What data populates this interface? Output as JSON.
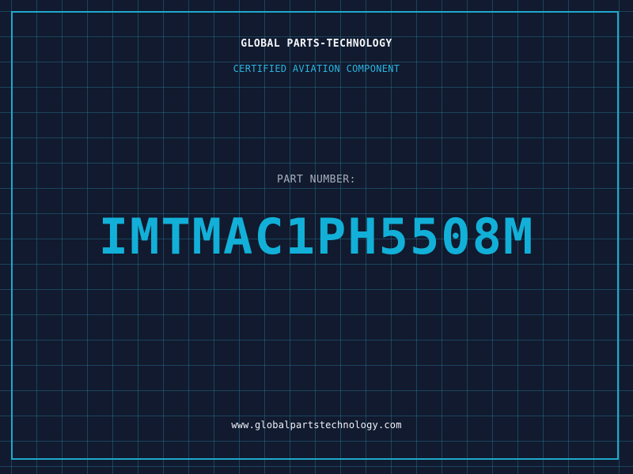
{
  "brand": {
    "name": "GLOBAL PARTS-TECHNOLOGY",
    "tagline": "CERTIFIED AVIATION COMPONENT"
  },
  "part": {
    "label": "PART NUMBER:",
    "number": "IMTMAC1PH5508M"
  },
  "footer": {
    "url": "www.globalpartstechnology.com"
  },
  "colors": {
    "background": "#111a2e",
    "grid": "#28789a",
    "frame": "#1fa8cc",
    "accent": "#12b0d8",
    "label": "#a8b0bf",
    "text": "#f4f6fa"
  }
}
